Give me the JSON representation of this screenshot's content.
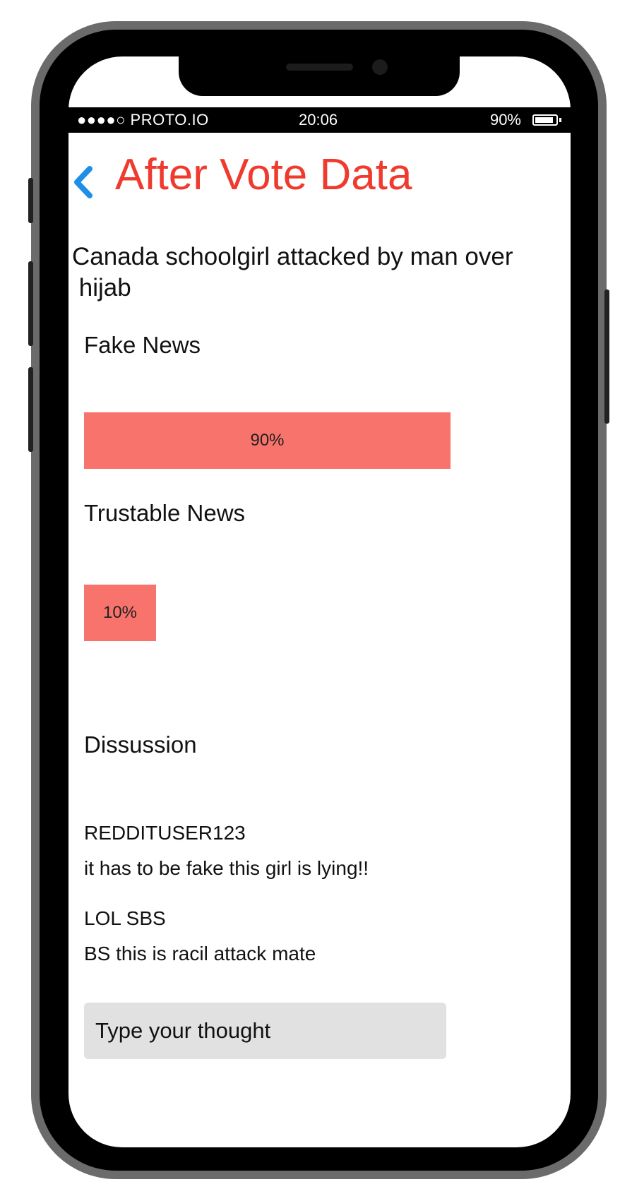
{
  "status_bar": {
    "carrier": "●●●●○ PROTO.IO",
    "time": "20:06",
    "battery_percent": "90%",
    "battery_level": 0.9
  },
  "header": {
    "back_icon": "chevron-left-icon",
    "title": "After Vote Data"
  },
  "article": {
    "headline": "Canada schoolgirl attacked by man over\n hijab"
  },
  "votes": [
    {
      "label": "Fake News",
      "percent_label": "90%",
      "value": 90
    },
    {
      "label": "Trustable News",
      "percent_label": "10%",
      "value": 10
    }
  ],
  "discussion": {
    "title": "Dissussion",
    "comments": [
      {
        "user": "REDDITUSER123",
        "text": "it has to be fake this girl is lying!!"
      },
      {
        "user": "LOL SBS",
        "text": "BS this is racil attack mate"
      }
    ],
    "input_placeholder": "Type your thought"
  },
  "colors": {
    "title": "#f03a2e",
    "back_icon": "#1e8fe8",
    "bar": "#f8736c",
    "input_bg": "#e1e1e1"
  }
}
